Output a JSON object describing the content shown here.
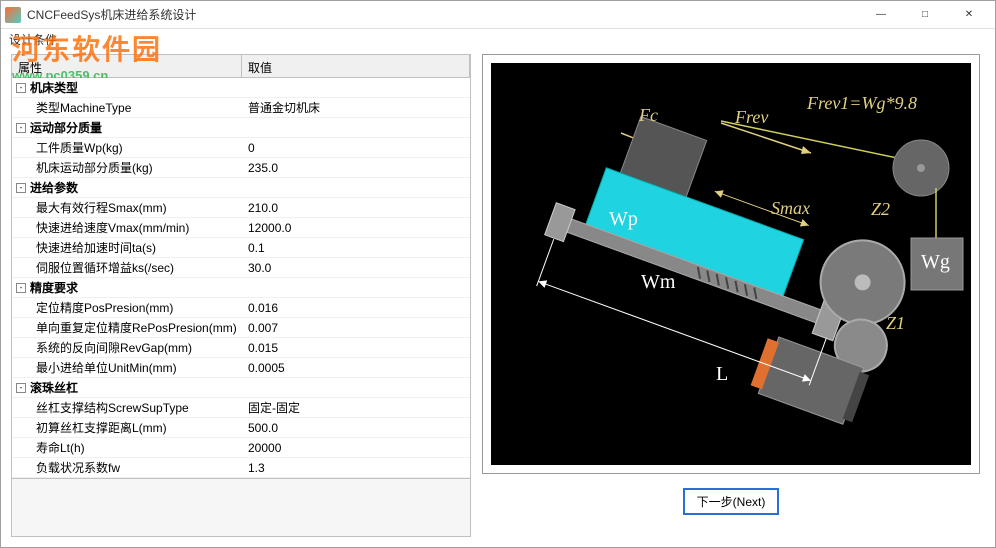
{
  "window": {
    "title": "CNCFeedSys机床进给系统设计"
  },
  "menu": {
    "design_conditions": "设计条件"
  },
  "watermark": {
    "cn": "河东软件园",
    "en": "www.pc0359.cn"
  },
  "grid": {
    "header_prop": "属性",
    "header_val": "取值",
    "categories": [
      {
        "key": "machine_type",
        "label": "机床类型",
        "items": [
          {
            "prop": "类型MachineType",
            "val": "普通金切机床"
          }
        ]
      },
      {
        "key": "moving_mass",
        "label": "运动部分质量",
        "items": [
          {
            "prop": "工件质量Wp(kg)",
            "val": "0"
          },
          {
            "prop": "机床运动部分质量(kg)",
            "val": "235.0"
          }
        ]
      },
      {
        "key": "feed_params",
        "label": "进给参数",
        "items": [
          {
            "prop": "最大有效行程Smax(mm)",
            "val": "210.0"
          },
          {
            "prop": "快速进给速度Vmax(mm/min)",
            "val": "12000.0"
          },
          {
            "prop": "快速进给加速时间ta(s)",
            "val": "0.1"
          },
          {
            "prop": "伺服位置循环增益ks(/sec)",
            "val": "30.0"
          }
        ]
      },
      {
        "key": "precision",
        "label": "精度要求",
        "items": [
          {
            "prop": "定位精度PosPresion(mm)",
            "val": "0.016"
          },
          {
            "prop": "单向重复定位精度RePosPresion(mm)",
            "val": "0.007"
          },
          {
            "prop": "系统的反向间隙RevGap(mm)",
            "val": "0.015"
          },
          {
            "prop": "最小进给单位UnitMin(mm)",
            "val": "0.0005"
          }
        ]
      },
      {
        "key": "ballscrew",
        "label": "滚珠丝杠",
        "items": [
          {
            "prop": "丝杠支撑结构ScrewSupType",
            "val": "固定-固定"
          },
          {
            "prop": "初算丝杠支撑距离L(mm)",
            "val": "500.0"
          },
          {
            "prop": "寿命Lt(h)",
            "val": "20000"
          },
          {
            "prop": "负载状况系数fw",
            "val": "1.3"
          }
        ]
      }
    ]
  },
  "diagram": {
    "labels": {
      "Fc": "Fc",
      "Frev": "Frev",
      "Frev1": "Frev1=Wg*9.8",
      "Wp": "Wp",
      "Smax": "Smax",
      "Z2": "Z2",
      "Wg": "Wg",
      "Wm": "Wm",
      "Z1": "Z1",
      "L": "L"
    }
  },
  "buttons": {
    "next": "下一步(Next)"
  },
  "controls": {
    "min": "—",
    "max": "□",
    "close": "✕"
  }
}
